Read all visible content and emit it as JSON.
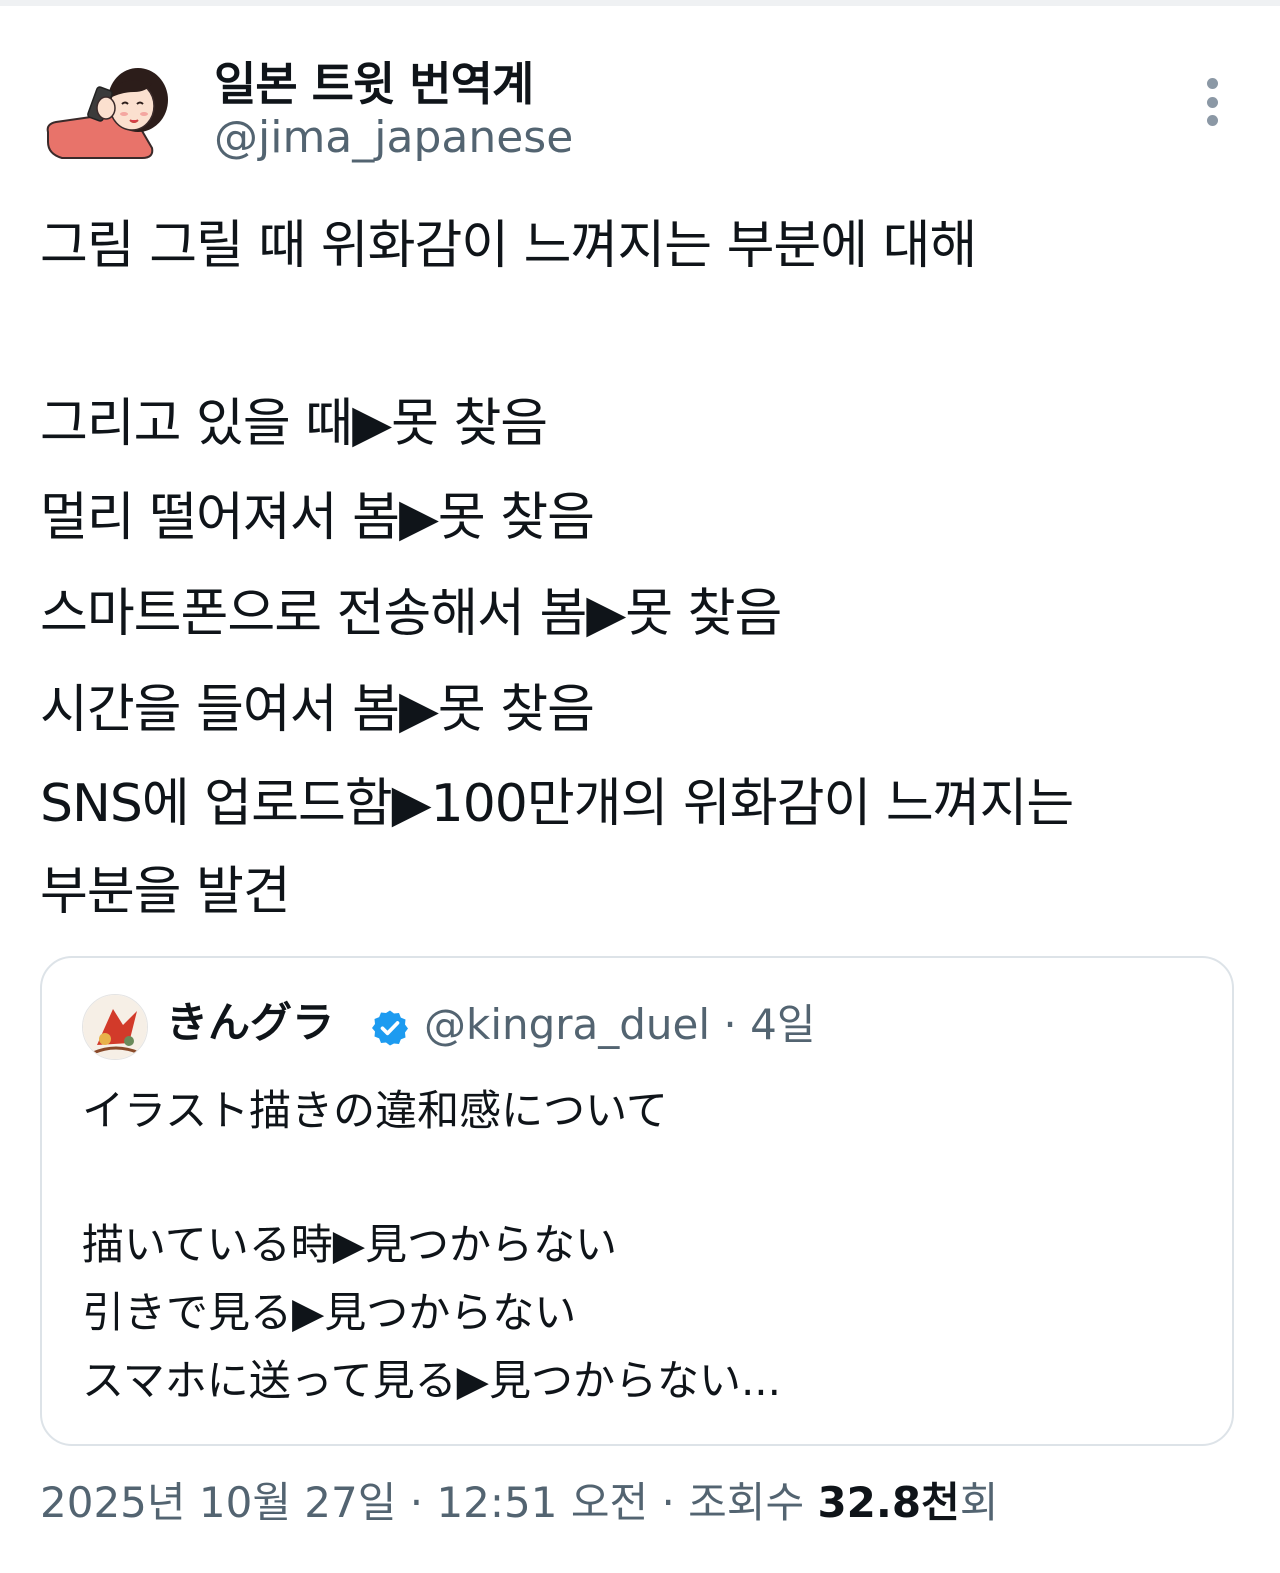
{
  "author": {
    "display_name": "일본 트윗 번역계",
    "handle": "@jima_japanese",
    "avatar_icon": "girl-on-phone-avatar"
  },
  "menu": {
    "icon": "more-vertical-icon"
  },
  "tweet": {
    "lines": [
      "그림 그릴 때 위화감이 느껴지는 부분에 대해",
      "그리고 있을 때▶못 찾음",
      "멀리 떨어져서 봄▶못 찾음",
      "스마트폰으로 전송해서 봄▶못 찾음",
      "시간을 들여서 봄▶못 찾음",
      "SNS에 업로드함▶100만개의 위화감이 느껴지는",
      "부분을 발견"
    ]
  },
  "quote": {
    "display_name": "きんグラ",
    "verified_icon": "verified-badge-icon",
    "verified_color": "#1d9bf0",
    "handle_and_time": "@kingra_duel · 4일",
    "lines": [
      "イラスト描きの違和感について",
      "描いている時▶見つからない",
      "引きで見る▶見つからない",
      "スマホに送って見る▶見つからない..."
    ]
  },
  "footer": {
    "timestamp": "2025년 10월 27일 · 12:51 오전 · 조회수 ",
    "views_count": "32.8천",
    "views_suffix": "회"
  }
}
